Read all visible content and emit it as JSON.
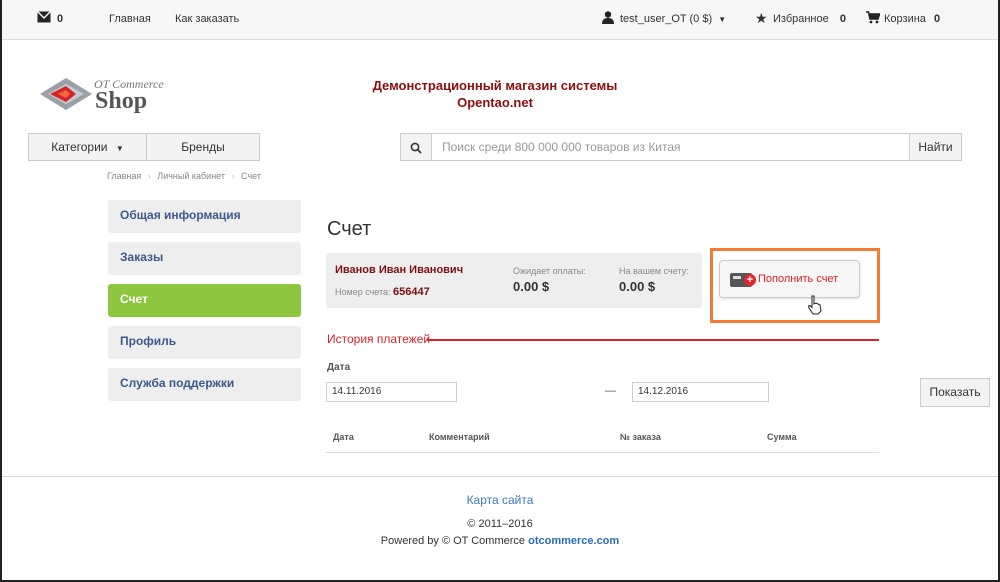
{
  "topbar": {
    "messages_count": "0",
    "home": "Главная",
    "how_to_order": "Как заказать",
    "user": "test_user_OT (0 $)",
    "favorites_label": "Избранное",
    "favorites_count": "0",
    "cart_label": "Корзина",
    "cart_count": "0"
  },
  "header": {
    "logo_sub": "OT Commerce",
    "logo_main": "Shop",
    "store_title_line1": "Демонстрационный магазин системы",
    "store_title_line2": "Opentao.net"
  },
  "nav": {
    "categories": "Категории",
    "brands": "Бренды",
    "search_placeholder": "Поиск среди 800 000 000 товаров из Китая",
    "search_button": "Найти"
  },
  "breadcrumb": [
    "Главная",
    "Личный кабинет",
    "Счет"
  ],
  "sidebar": {
    "items": [
      {
        "label": "Общая информация",
        "active": false
      },
      {
        "label": "Заказы",
        "active": false
      },
      {
        "label": "Счет",
        "active": true
      },
      {
        "label": "Профиль",
        "active": false
      },
      {
        "label": "Служба поддержки",
        "active": false
      }
    ]
  },
  "main": {
    "title": "Счет",
    "account": {
      "name": "Иванов Иван Иванович",
      "number_label": "Номер счета:",
      "number": "656447",
      "awaiting_label": "Ожидает оплаты:",
      "awaiting_value": "0.00 $",
      "balance_label": "На вашем счету:",
      "balance_value": "0.00 $"
    },
    "topup_button": "Пополнить счет",
    "history_title": "История платежей",
    "date_label": "Дата",
    "date_from": "14.11.2016",
    "date_separator": "—",
    "date_to": "14.12.2016",
    "show_button": "Показать",
    "table_headers": [
      "Дата",
      "Комментарий",
      "№ заказа",
      "Сумма"
    ]
  },
  "footer": {
    "sitemap": "Карта сайта",
    "copyright": "© 2011–2016",
    "powered_prefix": "Powered by © OT Commerce",
    "powered_link": "otcommerce.com"
  },
  "colors": {
    "accent_green": "#8dc63f",
    "highlight_orange": "#f47c30",
    "title_red": "#8b0e0e",
    "history_red": "#d8232a",
    "link_blue": "#3b7bbf"
  }
}
